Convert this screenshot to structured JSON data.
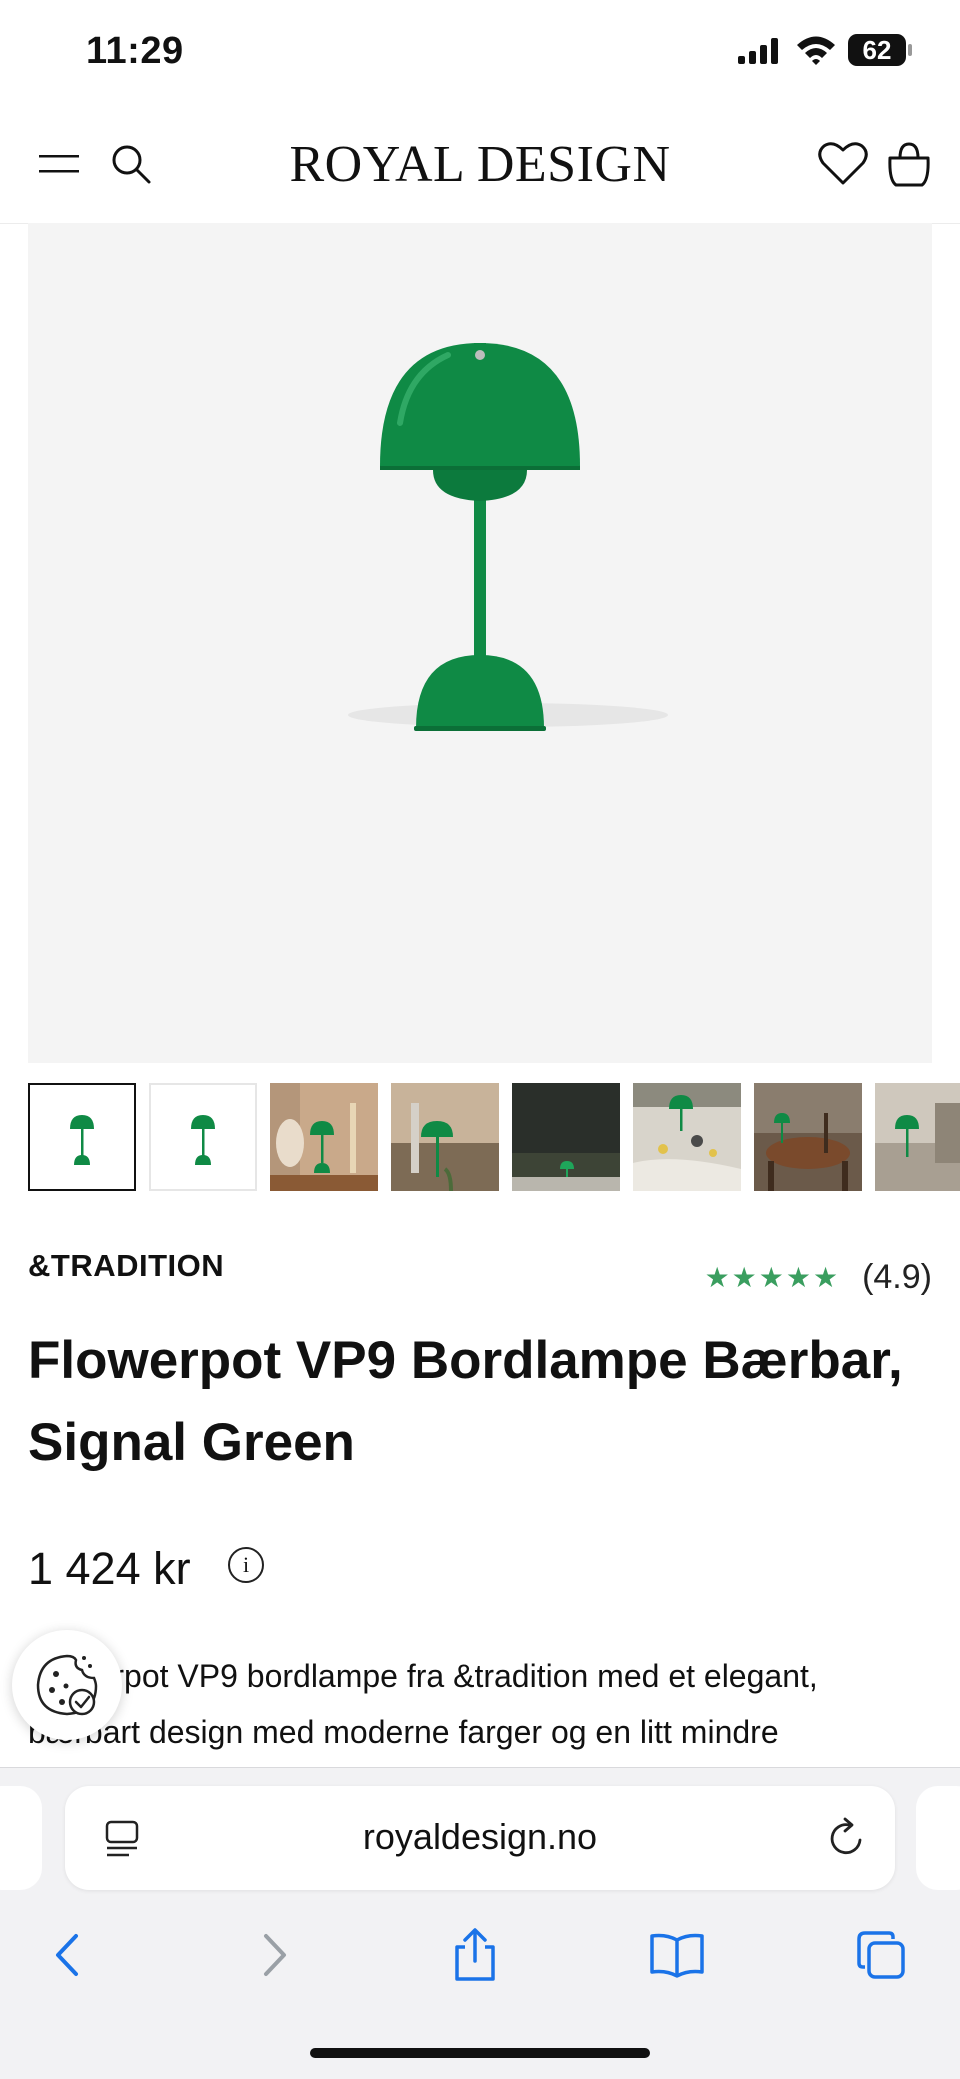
{
  "status_bar": {
    "time": "11:29",
    "battery": "62"
  },
  "header": {
    "logo": "ROYAL DESIGN"
  },
  "product": {
    "brand": "&TRADITION",
    "rating_stars": "★★★★★",
    "rating_value": "(4.9)",
    "title": "Flowerpot VP9 Bordlampe Bærbar, Signal Green",
    "price": "1 424 kr",
    "description": "Flowerpot VP9 bordlampe fra &tradition med et elegant, bærbart design med moderne farger og en litt mindre"
  },
  "gallery": {
    "thumbnail_count": 8,
    "active_index": 0
  },
  "colors": {
    "lamp_green": "#0f8a45",
    "star_green": "#3a9e5f",
    "ios_blue": "#1a73e8"
  },
  "browser": {
    "url": "royaldesign.no"
  },
  "icons": [
    "menu-icon",
    "search-icon",
    "heart-icon",
    "bag-icon",
    "info-icon",
    "cookie-icon",
    "reader-icon",
    "reload-icon",
    "back-icon",
    "forward-icon",
    "share-icon",
    "bookmarks-icon",
    "tabs-icon"
  ]
}
